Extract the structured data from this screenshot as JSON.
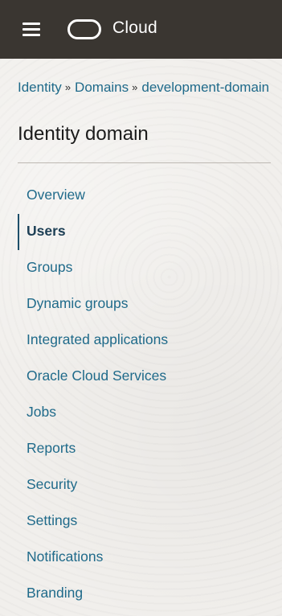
{
  "header": {
    "menu_icon": "hamburger-menu-icon",
    "logo_icon": "oracle-logo-icon",
    "brand": "Cloud",
    "background_color": "#3a3631"
  },
  "breadcrumb": {
    "items": [
      "Identity",
      "Domains",
      "development-domain"
    ],
    "separator": "»"
  },
  "page": {
    "title": "Identity domain"
  },
  "nav": {
    "active": "Users",
    "link_color": "#1f6a8a",
    "items": [
      "Overview",
      "Users",
      "Groups",
      "Dynamic groups",
      "Integrated applications",
      "Oracle Cloud Services",
      "Jobs",
      "Reports",
      "Security",
      "Settings",
      "Notifications",
      "Branding"
    ]
  }
}
